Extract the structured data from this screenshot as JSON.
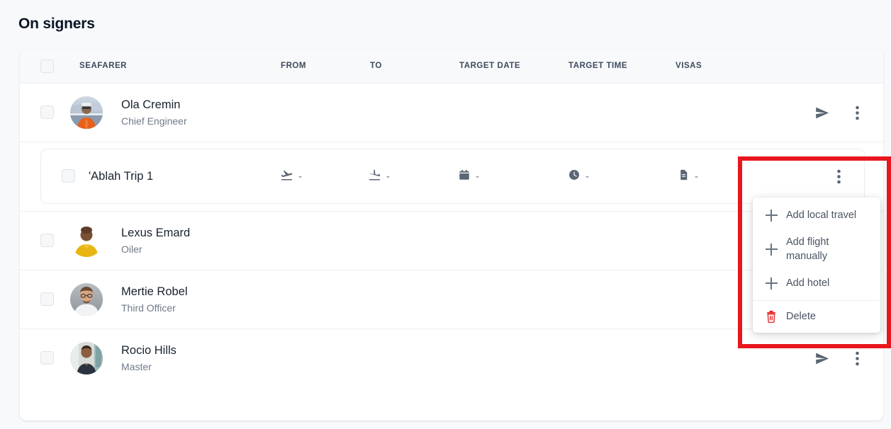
{
  "page": {
    "title": "On signers",
    "background_color": "#f8f9fb",
    "card_background": "#ffffff"
  },
  "table": {
    "select_all_checkbox": "unchecked",
    "columns": [
      {
        "key": "seafarer",
        "label": "SEAFARER"
      },
      {
        "key": "from",
        "label": "FROM"
      },
      {
        "key": "to",
        "label": "TO"
      },
      {
        "key": "target_date",
        "label": "TARGET DATE"
      },
      {
        "key": "target_time",
        "label": "TARGET TIME"
      },
      {
        "key": "visas",
        "label": "VISAS"
      }
    ],
    "rows": [
      {
        "name": "Ola Cremin",
        "rank": "Chief Engineer",
        "avatar": "photo-engineer-orange-coveralls",
        "checkbox": "unchecked",
        "actions": [
          "send-icon",
          "kebab-menu-icon"
        ]
      },
      {
        "name": "Lexus Emard",
        "rank": "Oiler",
        "avatar": "photo-man-yellow-shirt",
        "checkbox": "unchecked",
        "actions": [
          "send-icon",
          "kebab-menu-icon"
        ]
      },
      {
        "name": "Mertie Robel",
        "rank": "Third Officer",
        "avatar": "photo-man-glasses-white-shirt",
        "checkbox": "unchecked",
        "actions": [
          "send-icon",
          "kebab-menu-icon"
        ]
      },
      {
        "name": "Rocio Hills",
        "rank": "Master",
        "avatar": "photo-man-dark-tshirt",
        "checkbox": "unchecked",
        "actions": [
          "send-icon",
          "kebab-menu-icon"
        ]
      }
    ]
  },
  "trip": {
    "name": "'Ablah Trip 1",
    "checkbox": "unchecked",
    "cells": [
      {
        "key": "from",
        "icon": "flight-takeoff-icon",
        "value": "-"
      },
      {
        "key": "to",
        "icon": "flight-land-icon",
        "value": "-"
      },
      {
        "key": "target_date",
        "icon": "calendar-icon",
        "value": "-"
      },
      {
        "key": "target_time",
        "icon": "clock-icon",
        "value": "-"
      },
      {
        "key": "visas",
        "icon": "document-icon",
        "value": "-"
      }
    ]
  },
  "context_menu": {
    "items": [
      {
        "label": "Add local travel",
        "icon": "plus-icon"
      },
      {
        "label": "Add flight manually",
        "icon": "plus-icon"
      },
      {
        "label": "Add hotel",
        "icon": "plus-icon"
      },
      {
        "label": "Delete",
        "icon": "trash-icon"
      }
    ]
  },
  "highlight": {
    "color": "#e8161d"
  }
}
